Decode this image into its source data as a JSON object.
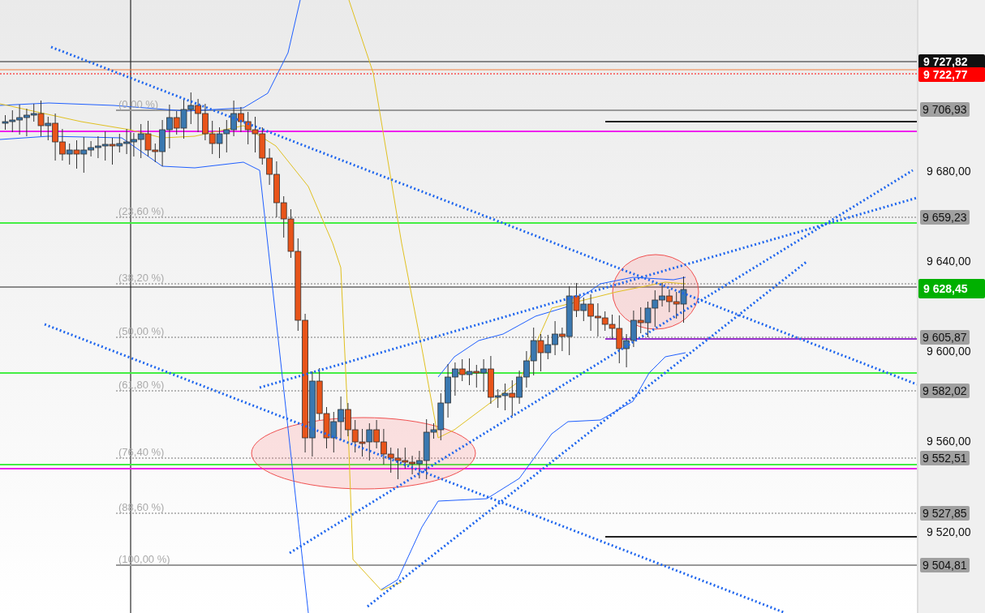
{
  "chart": {
    "fib_labels": [
      "(0,00 %)",
      "(23,60 %)",
      "(38,20 %)",
      "(50,00 %)",
      "(61,80 %)",
      "(76,40 %)",
      "(88,60 %)",
      "(100,00 %)"
    ],
    "price_axis": [
      {
        "label": "9 727,82",
        "kind": "high"
      },
      {
        "label": "9 722,77",
        "kind": "alert"
      },
      {
        "label": "9 706,93",
        "kind": "level"
      },
      {
        "label": "9 680,00",
        "kind": "tick"
      },
      {
        "label": "9 659,23",
        "kind": "level"
      },
      {
        "label": "9 640,00",
        "kind": "tick"
      },
      {
        "label": "9 628,45",
        "kind": "current"
      },
      {
        "label": "9 605,87",
        "kind": "level"
      },
      {
        "label": "9 600,00",
        "kind": "tick"
      },
      {
        "label": "9 582,02",
        "kind": "level"
      },
      {
        "label": "9 560,00",
        "kind": "tick"
      },
      {
        "label": "9 552,51",
        "kind": "level"
      },
      {
        "label": "9 527,85",
        "kind": "level"
      },
      {
        "label": "9 520,00",
        "kind": "tick"
      },
      {
        "label": "9 504,81",
        "kind": "level"
      }
    ]
  }
}
